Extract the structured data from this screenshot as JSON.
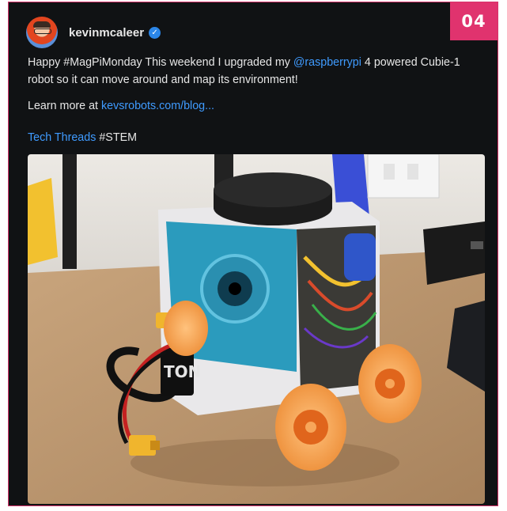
{
  "badge": {
    "number": "04"
  },
  "post": {
    "username": "kevinmcaleer",
    "verified_mark": "✓",
    "paragraph1": {
      "pre": "Happy #MagPiMonday This weekend I upgraded my ",
      "mention": "@raspberrypi",
      "post": " 4 powered Cubie-1 robot so it can move around and map its environment!"
    },
    "paragraph2": {
      "pre": "Learn more at ",
      "link": "kevsrobots.com/blog..."
    },
    "paragraph3": {
      "link": "Tech Threads",
      "hashtag": " #STEM"
    },
    "photo": {
      "robot_label": "TON"
    }
  },
  "colors": {
    "accent": "#e0336e",
    "link": "#3f9bff",
    "background": "#101214",
    "text": "#e6e6e6",
    "robot_blue": "#2b9bbd",
    "wheel_orange": "#f7a65a"
  }
}
